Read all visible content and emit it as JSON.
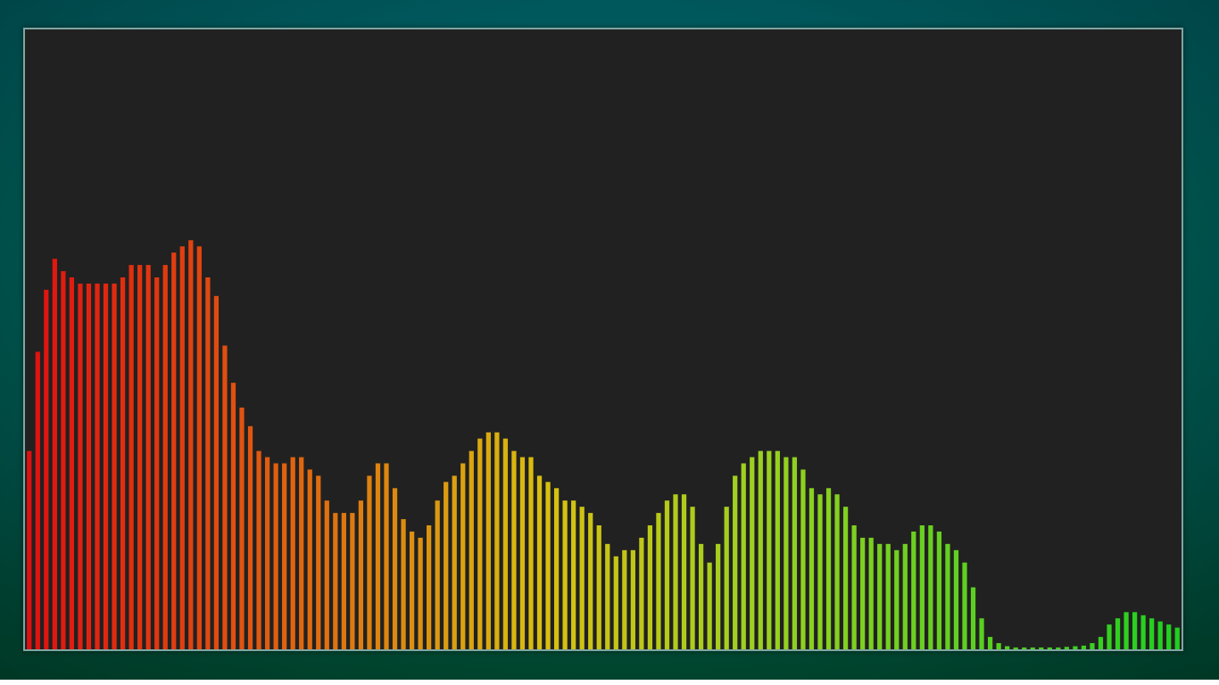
{
  "visualizer": {
    "type": "bar",
    "colors": {
      "low": "#e01010",
      "mid_low": "#e06010",
      "mid": "#d8c010",
      "mid_high": "#a0d020",
      "high": "#20d020",
      "panel_background": "#212121",
      "panel_border": "#7fa6a2",
      "frame_background": "#005a55"
    },
    "levels": [
      0.32,
      0.48,
      0.58,
      0.63,
      0.61,
      0.6,
      0.59,
      0.59,
      0.59,
      0.59,
      0.59,
      0.6,
      0.62,
      0.62,
      0.62,
      0.6,
      0.62,
      0.64,
      0.65,
      0.66,
      0.65,
      0.6,
      0.57,
      0.49,
      0.43,
      0.39,
      0.36,
      0.32,
      0.31,
      0.3,
      0.3,
      0.31,
      0.31,
      0.29,
      0.28,
      0.24,
      0.22,
      0.22,
      0.22,
      0.24,
      0.28,
      0.3,
      0.3,
      0.26,
      0.21,
      0.19,
      0.18,
      0.2,
      0.24,
      0.27,
      0.28,
      0.3,
      0.32,
      0.34,
      0.35,
      0.35,
      0.34,
      0.32,
      0.31,
      0.31,
      0.28,
      0.27,
      0.26,
      0.24,
      0.24,
      0.23,
      0.22,
      0.2,
      0.17,
      0.15,
      0.16,
      0.16,
      0.18,
      0.2,
      0.22,
      0.24,
      0.25,
      0.25,
      0.23,
      0.17,
      0.14,
      0.17,
      0.23,
      0.28,
      0.3,
      0.31,
      0.32,
      0.32,
      0.32,
      0.31,
      0.31,
      0.29,
      0.26,
      0.25,
      0.26,
      0.25,
      0.23,
      0.2,
      0.18,
      0.18,
      0.17,
      0.17,
      0.16,
      0.17,
      0.19,
      0.2,
      0.2,
      0.19,
      0.17,
      0.16,
      0.14,
      0.1,
      0.05,
      0.02,
      0.01,
      0.005,
      0.003,
      0.003,
      0.003,
      0.003,
      0.003,
      0.003,
      0.004,
      0.005,
      0.006,
      0.01,
      0.02,
      0.04,
      0.05,
      0.06,
      0.06,
      0.055,
      0.05,
      0.045,
      0.04,
      0.035
    ]
  }
}
